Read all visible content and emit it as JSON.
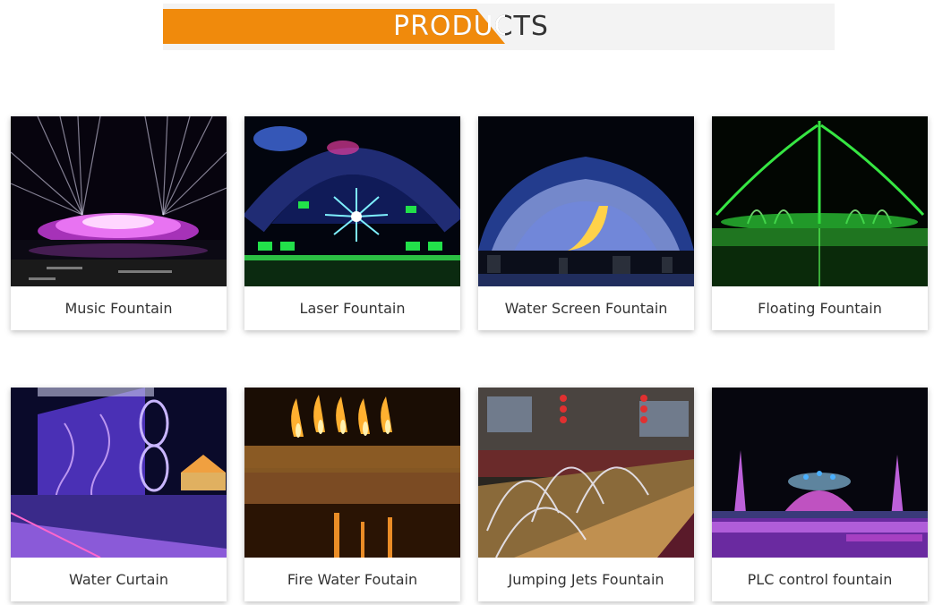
{
  "header": {
    "title": "PRODUCTS"
  },
  "products": [
    {
      "label": "Music Fountain",
      "icon": "music-fountain-photo"
    },
    {
      "label": "Laser Fountain",
      "icon": "laser-fountain-photo"
    },
    {
      "label": "Water Screen Fountain",
      "icon": "water-screen-fountain-photo"
    },
    {
      "label": "Floating Fountain",
      "icon": "floating-fountain-photo"
    },
    {
      "label": "Water Curtain",
      "icon": "water-curtain-photo"
    },
    {
      "label": "Fire Water Foutain",
      "icon": "fire-water-fountain-photo"
    },
    {
      "label": "Jumping Jets Fountain",
      "icon": "jumping-jets-fountain-photo"
    },
    {
      "label": "PLC control fountain",
      "icon": "plc-control-fountain-photo"
    }
  ],
  "colors": {
    "accent": "#f08a0c",
    "header_bg": "#f3f3f3",
    "text": "#333333"
  }
}
